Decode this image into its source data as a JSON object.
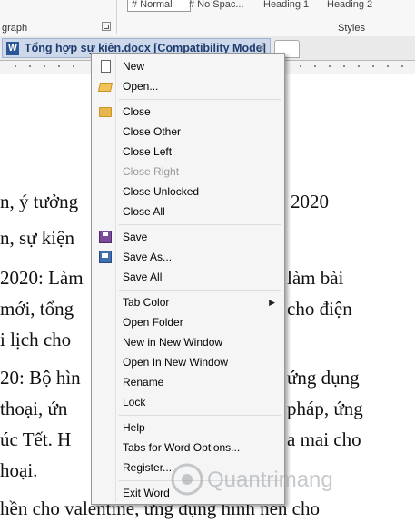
{
  "ribbon": {
    "styles": [
      "# Normal",
      "# No Spac...",
      "Heading 1",
      "Heading 2"
    ],
    "group_paragraph": "graph",
    "group_styles": "Styles"
  },
  "tab": {
    "title": "Tổng hợp sự kiện.docx [Compatibility Mode]",
    "close": "×",
    "icon": "word-icon"
  },
  "document": {
    "lines": [
      "n, ý tưởng",
      "2020",
      "n, sự kiện",
      "2020: Làm",
      "làm bài",
      " mới, tổng",
      "cho điện",
      "i lịch cho",
      "20: Bộ hìn",
      "ứng dụng",
      " thoại, ứn",
      "pháp, ứng",
      "úc Tết.  H",
      "a mai cho",
      "hoại.",
      "hền cho valentine, ứng dụng hình nền cho"
    ]
  },
  "context_menu": {
    "items": [
      {
        "label": "New",
        "icon": "new-doc-icon"
      },
      {
        "label": "Open...",
        "icon": "open-folder-icon"
      },
      {
        "label": "Close",
        "icon": "close-folder-icon"
      },
      {
        "label": "Close Other"
      },
      {
        "label": "Close Left"
      },
      {
        "label": "Close Right",
        "disabled": true
      },
      {
        "label": "Close Unlocked"
      },
      {
        "label": "Close All"
      },
      {
        "label": "Save",
        "icon": "save-icon"
      },
      {
        "label": "Save As...",
        "icon": "save-as-icon"
      },
      {
        "label": "Save All"
      },
      {
        "label": "Tab Color",
        "submenu": true
      },
      {
        "label": "Open Folder"
      },
      {
        "label": "New in New Window"
      },
      {
        "label": "Open In New Window"
      },
      {
        "label": "Rename"
      },
      {
        "label": "Lock"
      },
      {
        "label": "Help"
      },
      {
        "label": "Tabs for Word Options..."
      },
      {
        "label": "Register..."
      },
      {
        "label": "Exit Word"
      }
    ]
  },
  "watermark": {
    "text": "Quantrimang"
  },
  "colors": {
    "menu_bg": "#f5f5f5",
    "tab_bg": "#cdd9ea",
    "tab_text": "#1e3c6e"
  }
}
